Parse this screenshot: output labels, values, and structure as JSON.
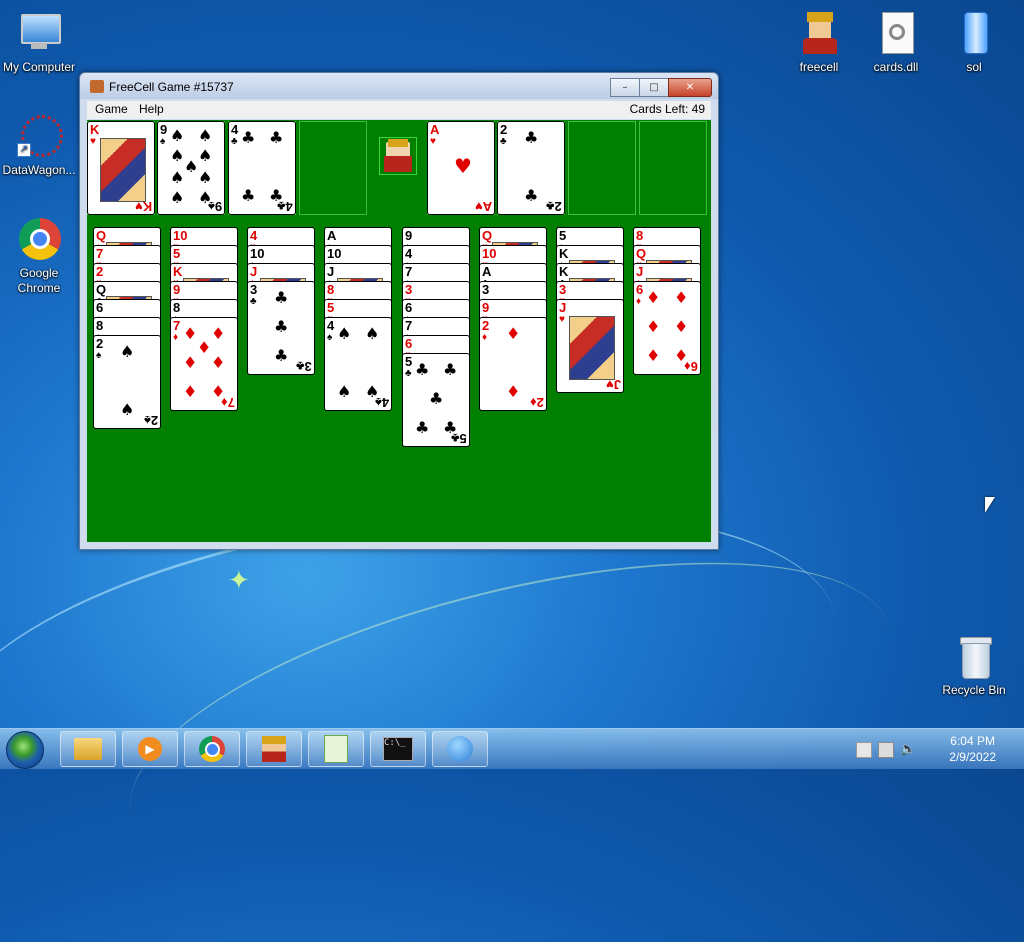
{
  "desktop": {
    "icons": [
      {
        "label": "My Computer"
      },
      {
        "label": "DataWagon..."
      },
      {
        "label": "Google Chrome"
      },
      {
        "label": "freecell"
      },
      {
        "label": "cards.dll"
      },
      {
        "label": "sol"
      },
      {
        "label": "Recycle Bin"
      }
    ]
  },
  "window": {
    "title": "FreeCell Game #15737",
    "menu": [
      "Game",
      "Help"
    ],
    "cards_left": "Cards Left: 49",
    "buttons": {
      "minimize": "–",
      "maximize": "□",
      "close": "✕"
    }
  },
  "freecells": [
    {
      "rank": "K",
      "suit": "♥"
    },
    {
      "rank": "9",
      "suit": "♠"
    },
    {
      "rank": "4",
      "suit": "♣"
    },
    null
  ],
  "foundations": [
    {
      "rank": "A",
      "suit": "♥"
    },
    {
      "rank": "2",
      "suit": "♣"
    },
    null,
    null
  ],
  "tableau": [
    [
      "Q♦",
      "7♥",
      "2♥",
      "Q♣",
      "6♠",
      "8♠",
      "2♠"
    ],
    [
      "10♥",
      "5♥",
      "K♥",
      "9♥",
      "8♠",
      "7♦"
    ],
    [
      "4♥",
      "10♠",
      "J♦",
      "3♣"
    ],
    [
      "A♠",
      "10♠",
      "J♠",
      "8♥",
      "5♥",
      "4♠"
    ],
    [
      "9♠",
      "4♠",
      "7♠",
      "3♥",
      "6♠",
      "7♠",
      "6♥",
      "5♣"
    ],
    [
      "Q♥",
      "10♥",
      "A♣",
      "3♠",
      "9♥",
      "2♦"
    ],
    [
      "5♠",
      "K♠",
      "K♣",
      "3♥",
      "J♥"
    ],
    [
      "8♥",
      "Q♥",
      "J♦",
      "6♦"
    ]
  ],
  "taskbar": {
    "time": "6:04 PM",
    "date": "2/9/2022"
  }
}
